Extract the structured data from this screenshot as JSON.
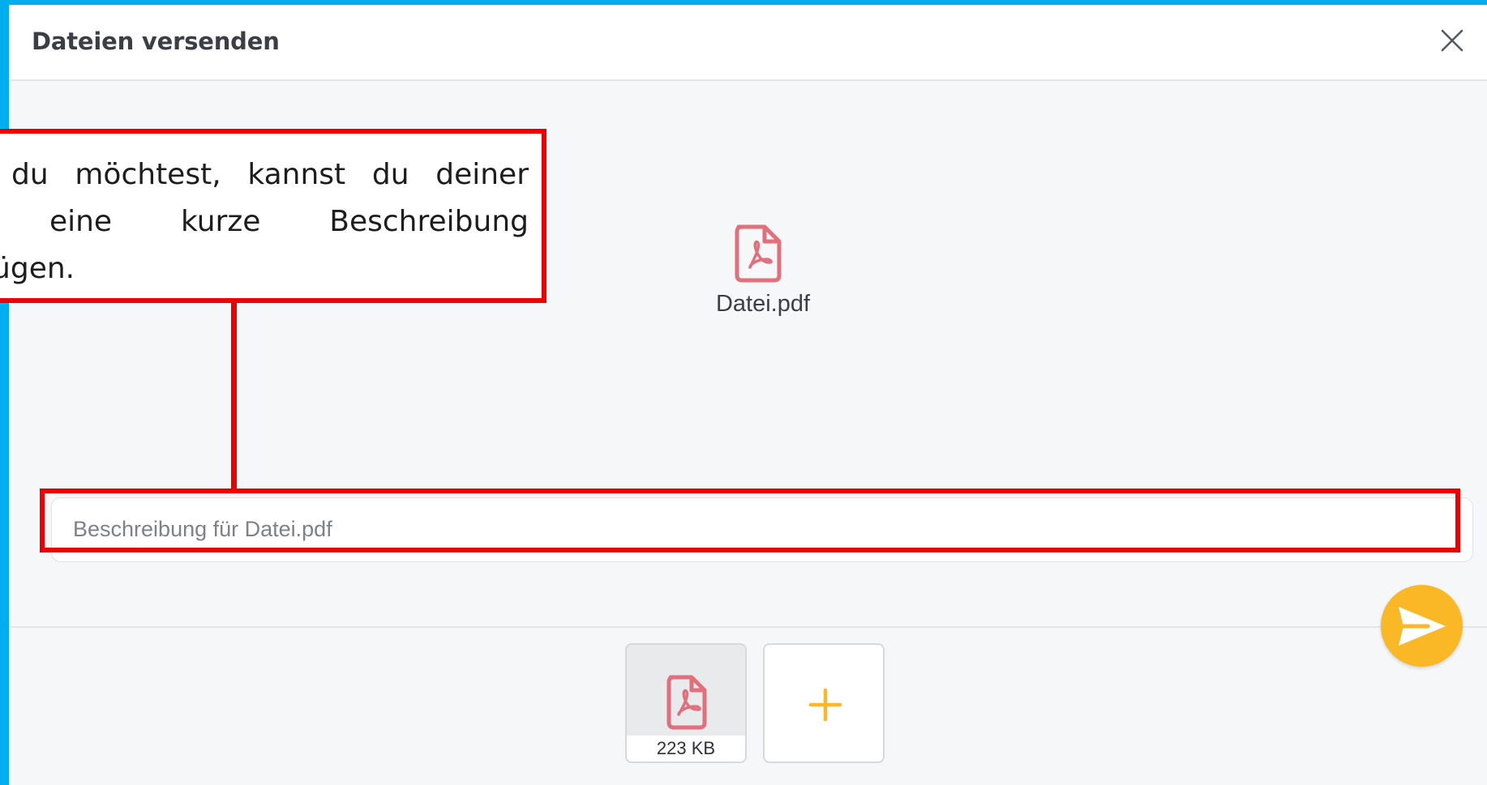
{
  "dialog": {
    "title": "Dateien versenden",
    "close_icon": "close-icon"
  },
  "preview": {
    "file_name": "Datei.pdf",
    "icon": "pdf-file-icon",
    "icon_color": "#e0707c"
  },
  "description": {
    "placeholder": "Beschreibung für Datei.pdf",
    "value": ""
  },
  "send": {
    "icon": "send-icon",
    "color": "#fbb826"
  },
  "attachments": [
    {
      "icon": "pdf-file-icon",
      "size": "223 KB"
    }
  ],
  "add_button": {
    "icon": "plus-icon",
    "color": "#fbb826"
  },
  "annotation": {
    "text": "Wenn du möchtest, kannst du deiner Datei eine kurze Beschreibung hinzufügen.",
    "visible_text": "du möchtest, kannst du deiner eine kurze Beschreibung gen.",
    "highlight_color": "#ee0000"
  }
}
